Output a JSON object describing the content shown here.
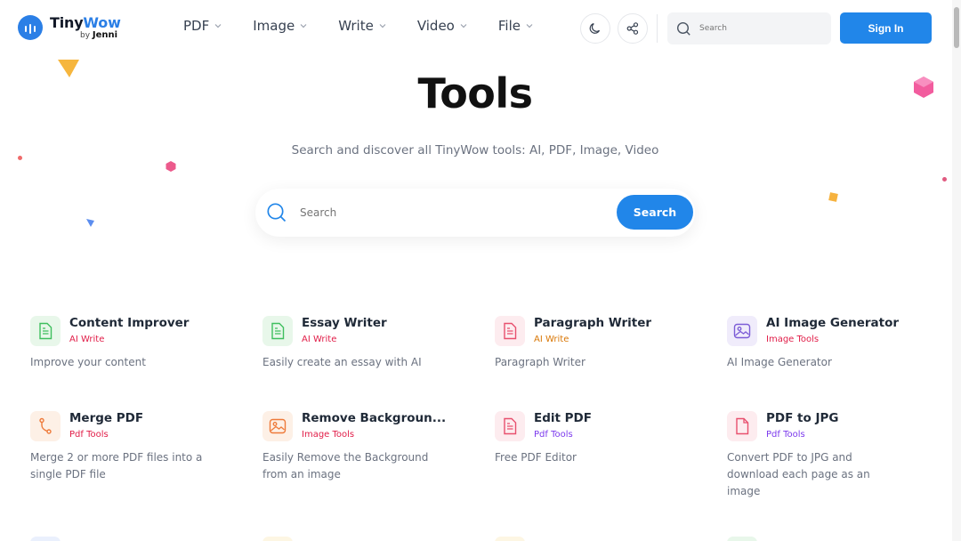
{
  "header": {
    "logo_name_a": "Tiny",
    "logo_name_b": "Wow",
    "logo_by": "by",
    "logo_by_brand": "Jenni",
    "nav": [
      {
        "label": "PDF"
      },
      {
        "label": "Image"
      },
      {
        "label": "Write"
      },
      {
        "label": "Video"
      },
      {
        "label": "File"
      }
    ],
    "search_placeholder": "Search",
    "signin_label": "Sign In"
  },
  "hero": {
    "title": "Tools",
    "subtitle": "Search and discover all TinyWow tools: AI, PDF, Image, Video",
    "search_placeholder": "Search",
    "search_button": "Search"
  },
  "colors": {
    "accent": "#2186e9",
    "ai_write": "#e11d48",
    "image_tools": "#e11d48",
    "pdf_tools": "#7c3aed"
  },
  "tools": [
    {
      "name": "Content Improver",
      "category": "AI Write",
      "description": "Improve your content",
      "icon": "document-icon"
    },
    {
      "name": "Essay Writer",
      "category": "AI Write",
      "description": "Easily create an essay with AI",
      "icon": "document-icon"
    },
    {
      "name": "Paragraph Writer",
      "category": "AI Write",
      "description": "Paragraph Writer",
      "icon": "document-icon"
    },
    {
      "name": "AI Image Generator",
      "category": "Image Tools",
      "description": "AI Image Generator",
      "icon": "image-icon"
    },
    {
      "name": "Merge PDF",
      "category": "Pdf Tools",
      "description": "Merge 2 or more PDF files into a single PDF file",
      "icon": "merge-icon"
    },
    {
      "name": "Remove Backgroun...",
      "category": "Image Tools",
      "description": "Easily Remove the Background from an image",
      "icon": "image-icon"
    },
    {
      "name": "Edit PDF",
      "category": "Pdf Tools",
      "description": "Free PDF Editor",
      "icon": "document-icon"
    },
    {
      "name": "PDF to JPG",
      "category": "Pdf Tools",
      "description": "Convert PDF to JPG and download each page as an image",
      "icon": "file-icon"
    }
  ]
}
